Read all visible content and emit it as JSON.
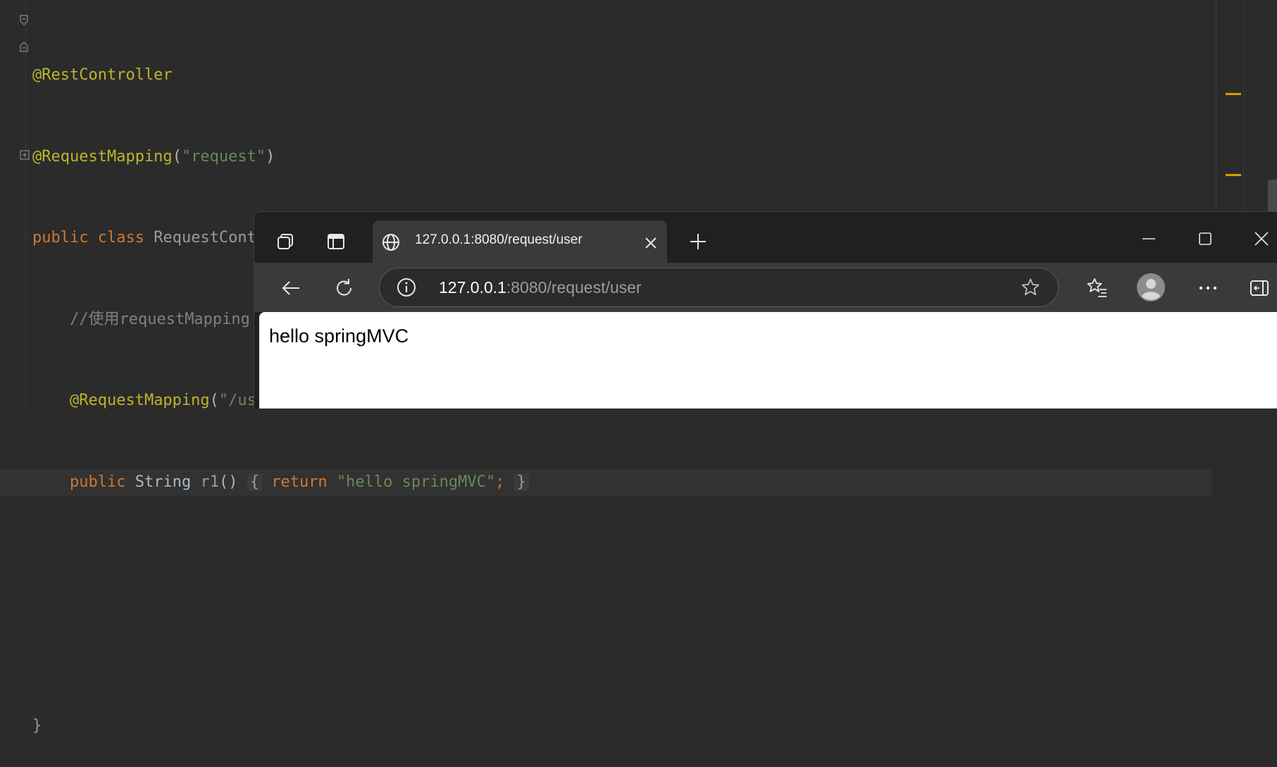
{
  "editor": {
    "lines": [
      {
        "annotation": "@RestController"
      },
      {
        "annotation": "@RequestMapping",
        "open": "(",
        "string": "\"request\"",
        "close": ")"
      },
      {
        "kw_public": "public",
        "kw_class": "class",
        "class_name": "RequestController",
        "brace": "{"
      },
      {
        "comment": "//使用requestMapping"
      },
      {
        "annotation": "@RequestMapping",
        "open": "(",
        "string": "\"/user\"",
        "close": ")"
      },
      {
        "kw_public": "public",
        "type": "String",
        "method": "r1",
        "parens": "()",
        "brace_open": "{",
        "kw_return": "return",
        "string": "\"hello springMVC\"",
        "semicolon": ";",
        "brace_close": "}"
      },
      {},
      {},
      {
        "brace": "}"
      }
    ],
    "marker_color": "#d89e00"
  },
  "browser": {
    "tab_title": "127.0.0.1:8080/request/user",
    "url_host": "127.0.0.1",
    "url_rest": ":8080/request/user",
    "page_text": "hello springMVC",
    "icons": [
      "workspaces-icon",
      "vertical-tabs-icon",
      "globe-icon",
      "close-tab-icon",
      "new-tab-icon",
      "minimize-icon",
      "maximize-icon",
      "close-window-icon",
      "back-icon",
      "refresh-icon",
      "info-icon",
      "favorite-star-icon",
      "favorites-icon",
      "profile-avatar-icon",
      "more-icon",
      "sidebar-icon"
    ]
  }
}
